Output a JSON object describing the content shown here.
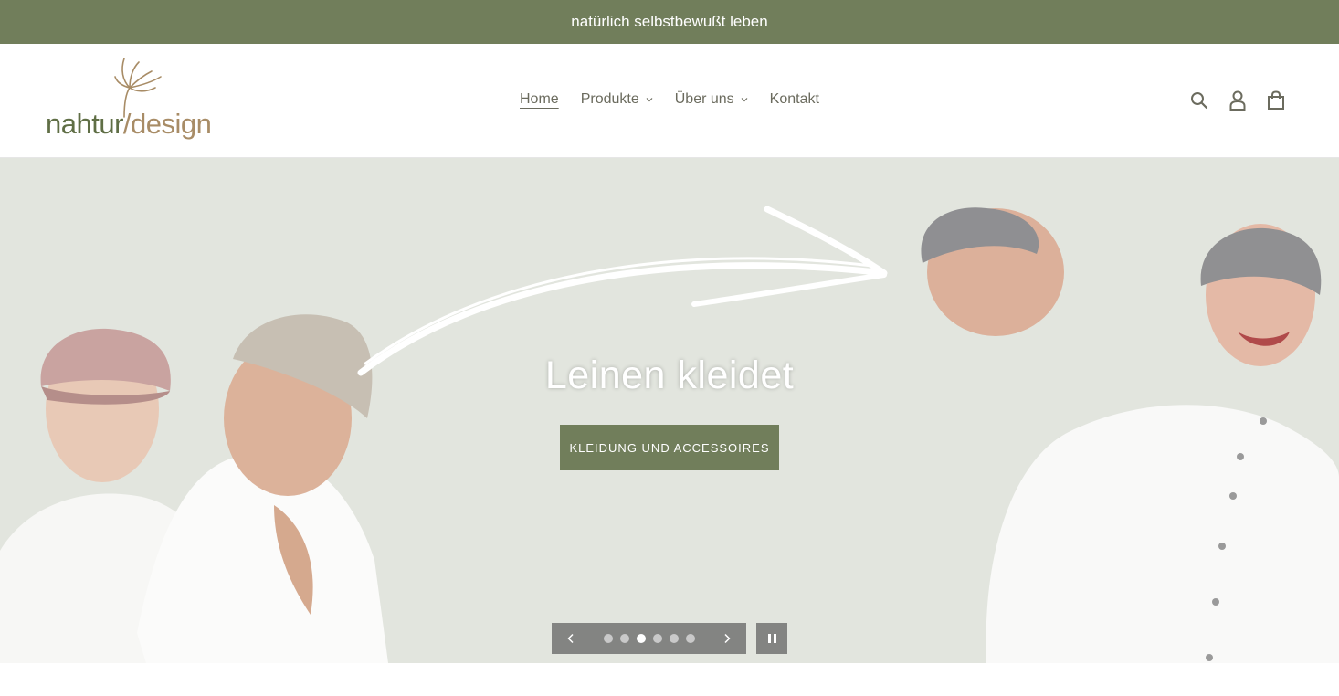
{
  "announcement": {
    "text": "natürlich selbstbewußt leben"
  },
  "logo": {
    "part1": "nahtur",
    "separator": "/",
    "part2": "design"
  },
  "nav": {
    "items": [
      {
        "label": "Home",
        "active": true,
        "dropdown": false
      },
      {
        "label": "Produkte",
        "active": false,
        "dropdown": true
      },
      {
        "label": "Über uns",
        "active": false,
        "dropdown": true
      },
      {
        "label": "Kontakt",
        "active": false,
        "dropdown": false
      }
    ]
  },
  "header_icons": [
    "search-icon",
    "account-icon",
    "cart-icon"
  ],
  "hero": {
    "title": "Leinen kleidet",
    "button_label": "KLEIDUNG UND ACCESSOIRES",
    "slides_total": 6,
    "active_slide": 3
  },
  "colors": {
    "brand_green": "#717e5b",
    "brand_tan": "#a88c66",
    "hero_bg": "#e2e5de",
    "nav_text": "#6b6b5e"
  }
}
